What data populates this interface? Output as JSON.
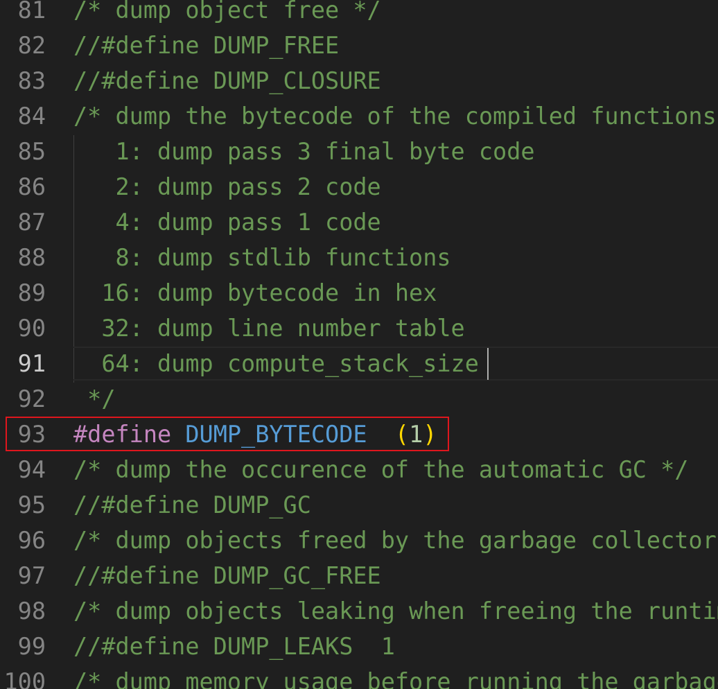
{
  "editor": {
    "lines": [
      {
        "num": "81",
        "tokens": [
          {
            "text": "/* dump object free */",
            "type": "comment"
          }
        ]
      },
      {
        "num": "82",
        "tokens": [
          {
            "text": "//#define DUMP_FREE",
            "type": "comment"
          }
        ]
      },
      {
        "num": "83",
        "tokens": [
          {
            "text": "//#define DUMP_CLOSURE",
            "type": "comment"
          }
        ]
      },
      {
        "num": "84",
        "tokens": [
          {
            "text": "/* dump the bytecode of the compiled functions",
            "type": "comment"
          }
        ]
      },
      {
        "num": "85",
        "tokens": [
          {
            "text": "   1: dump pass 3 final byte code",
            "type": "comment"
          }
        ]
      },
      {
        "num": "86",
        "tokens": [
          {
            "text": "   2: dump pass 2 code",
            "type": "comment"
          }
        ]
      },
      {
        "num": "87",
        "tokens": [
          {
            "text": "   4: dump pass 1 code",
            "type": "comment"
          }
        ]
      },
      {
        "num": "88",
        "tokens": [
          {
            "text": "   8: dump stdlib functions",
            "type": "comment"
          }
        ]
      },
      {
        "num": "89",
        "tokens": [
          {
            "text": "  16: dump bytecode in hex",
            "type": "comment"
          }
        ]
      },
      {
        "num": "90",
        "tokens": [
          {
            "text": "  32: dump line number table",
            "type": "comment"
          }
        ]
      },
      {
        "num": "91",
        "active": true,
        "tokens": [
          {
            "text": "  64: dump compute_stack_size",
            "type": "comment"
          }
        ]
      },
      {
        "num": "92",
        "tokens": [
          {
            "text": " */",
            "type": "comment"
          }
        ]
      },
      {
        "num": "93",
        "highlighted": true,
        "tokens": [
          {
            "text": "#define",
            "type": "keyword"
          },
          {
            "text": " ",
            "type": "plain"
          },
          {
            "text": "DUMP_BYTECODE",
            "type": "macro"
          },
          {
            "text": "  ",
            "type": "plain"
          },
          {
            "text": "(",
            "type": "paren"
          },
          {
            "text": "1",
            "type": "number"
          },
          {
            "text": ")",
            "type": "paren"
          }
        ]
      },
      {
        "num": "94",
        "tokens": [
          {
            "text": "/* dump the occurence of the automatic GC */",
            "type": "comment"
          }
        ]
      },
      {
        "num": "95",
        "tokens": [
          {
            "text": "//#define DUMP_GC",
            "type": "comment"
          }
        ]
      },
      {
        "num": "96",
        "tokens": [
          {
            "text": "/* dump objects freed by the garbage collector",
            "type": "comment"
          }
        ]
      },
      {
        "num": "97",
        "tokens": [
          {
            "text": "//#define DUMP_GC_FREE",
            "type": "comment"
          }
        ]
      },
      {
        "num": "98",
        "tokens": [
          {
            "text": "/* dump objects leaking when freeing the runtime",
            "type": "comment"
          }
        ]
      },
      {
        "num": "99",
        "tokens": [
          {
            "text": "//#define DUMP_LEAKS  1",
            "type": "comment"
          }
        ]
      },
      {
        "num": "100",
        "tokens": [
          {
            "text": "/* dump memory usage before running the garbage",
            "type": "comment"
          }
        ]
      }
    ],
    "colors": {
      "background": "#1f1f1f",
      "comment": "#6a9955",
      "keyword": "#c586c0",
      "macro": "#569cd6",
      "paren": "#ffd700",
      "number": "#b5cea8",
      "line_number": "#858585",
      "line_number_active": "#cccccc",
      "highlight_border": "#e0161d"
    }
  }
}
